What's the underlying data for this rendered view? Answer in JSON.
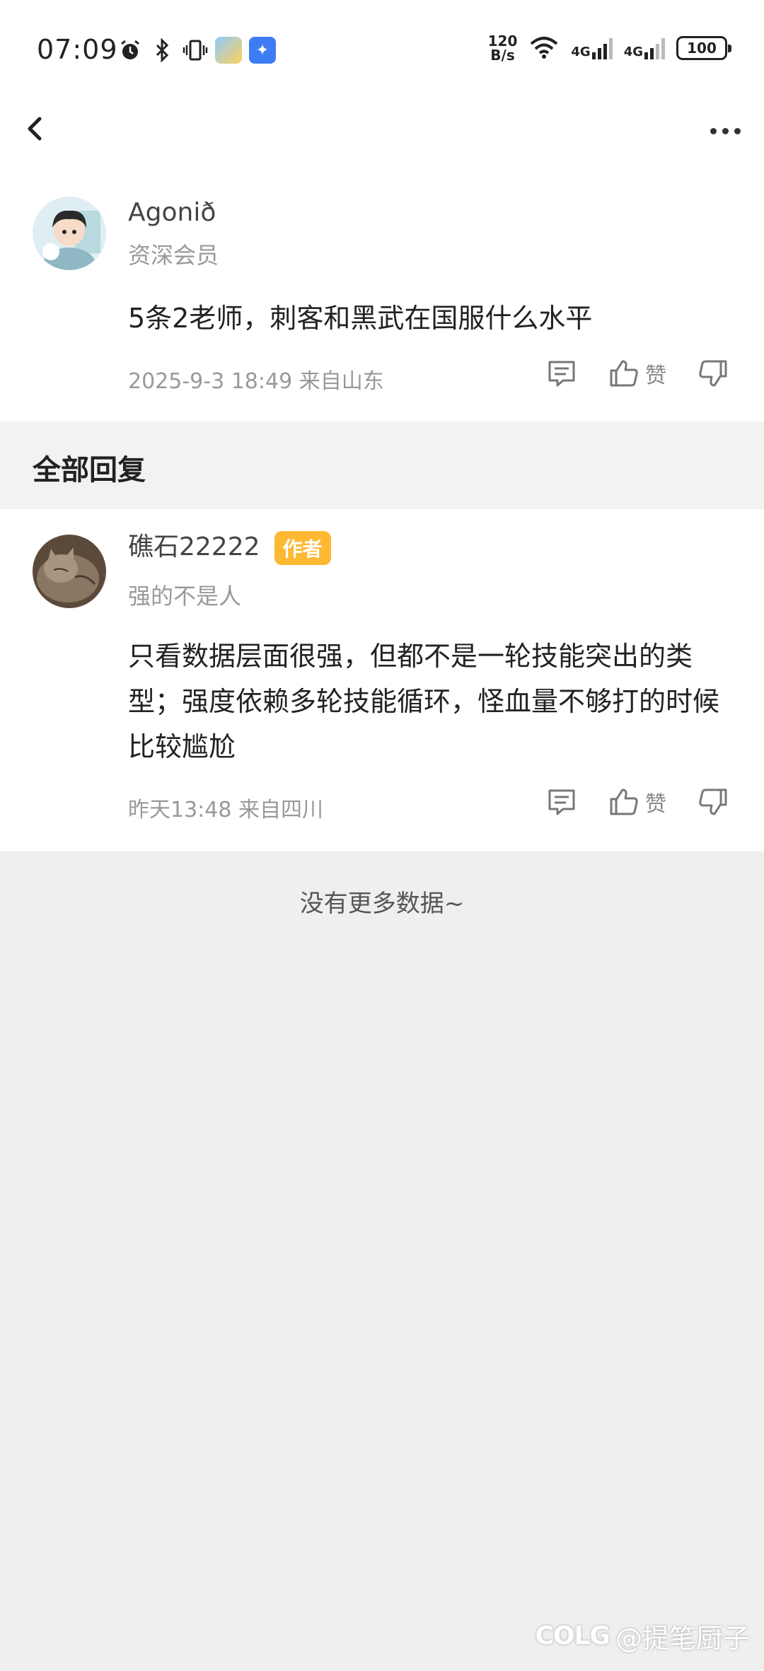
{
  "status_bar": {
    "time": "07:09",
    "speed_value": "120",
    "speed_unit": "B/s",
    "net1": "4G",
    "net2": "4G",
    "battery": "100"
  },
  "post": {
    "username": "Agonið",
    "user_title": "资深会员",
    "content": "5条2老师，刺客和黑武在国服什么水平",
    "meta": "2025-9-3 18:49  来自山东",
    "like_label": "赞"
  },
  "section": {
    "title": "全部回复"
  },
  "reply": {
    "username": "礁石22222",
    "badge": "作者",
    "user_title": "强的不是人",
    "content": "只看数据层面很强，但都不是一轮技能突出的类型；强度依赖多轮技能循环，怪血量不够打的时候比较尴尬",
    "meta": "昨天13:48 来自四川",
    "like_label": "赞"
  },
  "footer": {
    "no_more": "没有更多数据~"
  },
  "watermark": {
    "logo": "COLG",
    "text": "@提笔厨子"
  },
  "colors": {
    "badge": "#ffb833",
    "background": "#efefef"
  },
  "icons": [
    "back-icon",
    "more-icon",
    "comment-icon",
    "thumbs-up-icon",
    "thumbs-down-icon",
    "alarm-icon",
    "bluetooth-icon",
    "vibrate-icon",
    "wifi-icon"
  ]
}
